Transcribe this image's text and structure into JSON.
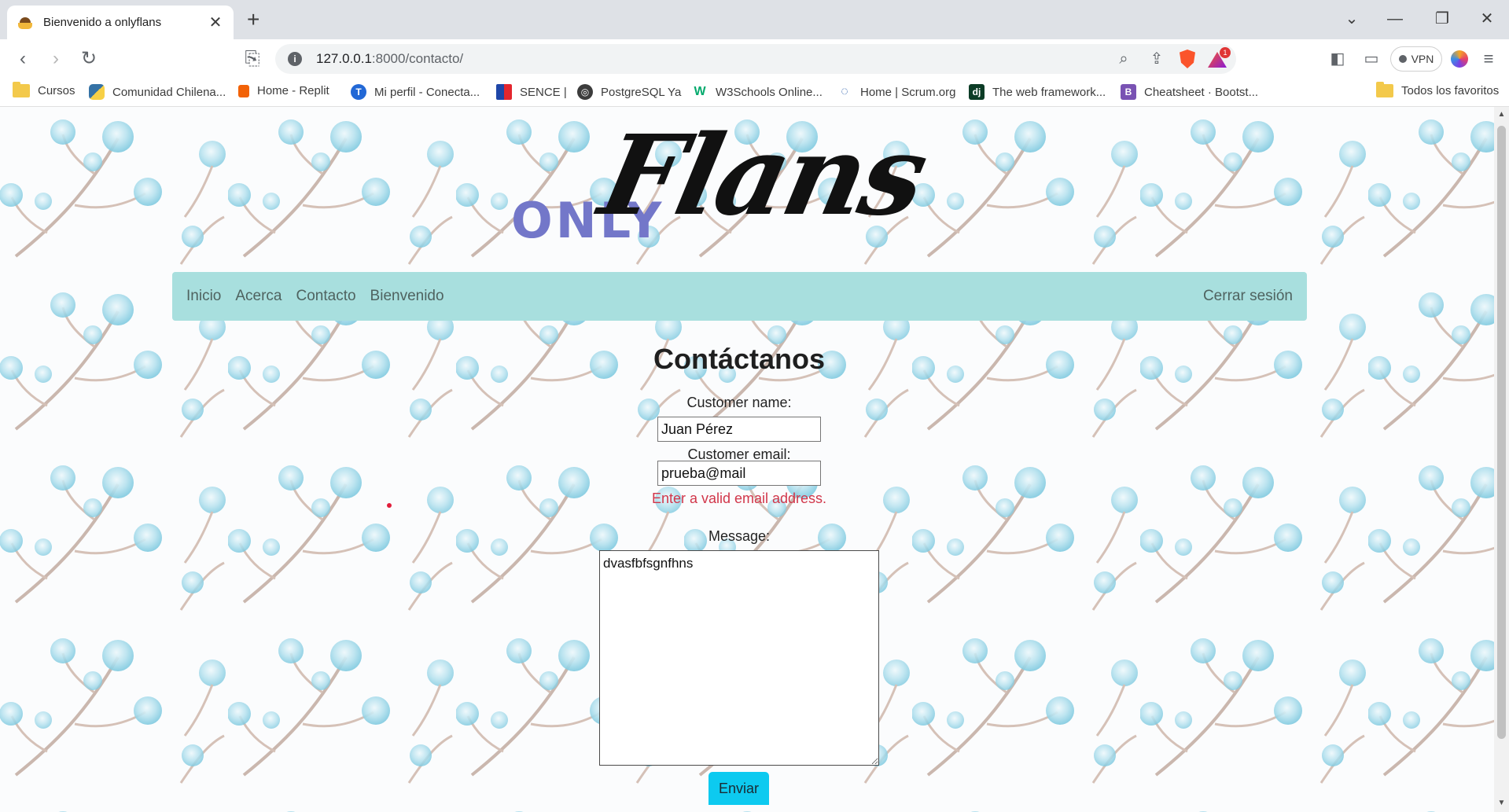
{
  "browser": {
    "tab_title": "Bienvenido a onlyflans",
    "tab_close": "✕",
    "new_tab": "+",
    "url_host": "127.0.0.1",
    "url_path": ":8000/contacto/",
    "vpn_label": "VPN",
    "badge_count": "1",
    "bookmarks": [
      {
        "label": "Cursos",
        "icon": "folder-icon"
      },
      {
        "label": "Comunidad Chilena...",
        "icon": "python-icon"
      },
      {
        "label": "Home - Replit",
        "icon": "replit-icon"
      },
      {
        "label": "Mi perfil - Conecta...",
        "icon": "t-icon"
      },
      {
        "label": "SENCE |",
        "icon": "sence-icon"
      },
      {
        "label": "PostgreSQL Ya",
        "icon": "globe-icon"
      },
      {
        "label": "W3Schools Online...",
        "icon": "w3-icon"
      },
      {
        "label": "Home | Scrum.org",
        "icon": "scrum-icon"
      },
      {
        "label": "The web framework...",
        "icon": "django-icon"
      },
      {
        "label": "Cheatsheet · Bootst...",
        "icon": "bootstrap-icon"
      }
    ],
    "all_bookmarks": "Todos los favoritos"
  },
  "site": {
    "logo_only": "ONLY",
    "logo_flans": "Flans",
    "nav": {
      "items": [
        "Inicio",
        "Acerca",
        "Contacto",
        "Bienvenido"
      ],
      "logout": "Cerrar sesión"
    },
    "nav_color": "#a8dfde"
  },
  "form": {
    "title": "Contáctanos",
    "name_label": "Customer name:",
    "name_value": "Juan Pérez",
    "email_label": "Customer email:",
    "email_value": "prueba@mail",
    "email_error": "Enter a valid email address.",
    "message_label": "Message:",
    "message_value": "dvasfbfsgnfhns",
    "submit": "Enviar",
    "error_color": "#d1364a",
    "submit_color": "#0dcaf0"
  }
}
